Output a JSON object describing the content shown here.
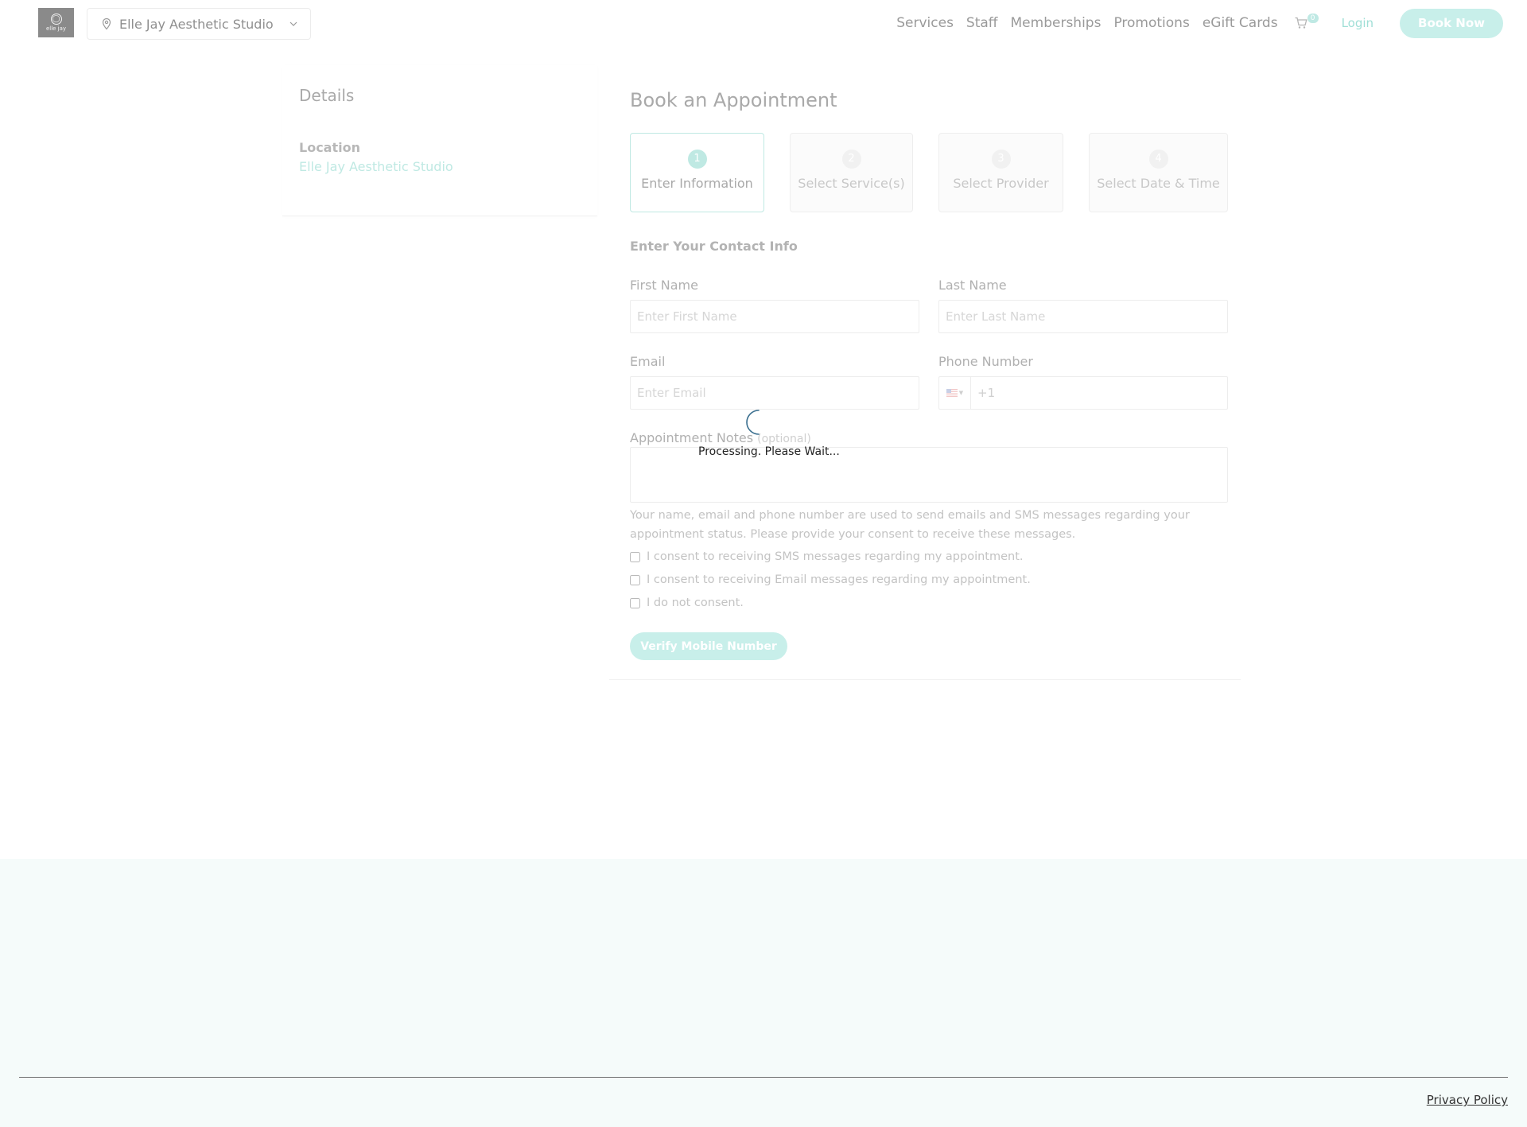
{
  "header": {
    "logo_text": "elle jay",
    "location": "Elle Jay Aesthetic Studio",
    "nav": [
      "Services",
      "Staff",
      "Memberships",
      "Promotions",
      "eGift Cards"
    ],
    "cart_count": "0",
    "login_label": "Login",
    "book_now_label": "Book Now"
  },
  "details": {
    "title": "Details",
    "location_label": "Location",
    "location_value": "Elle Jay Aesthetic Studio"
  },
  "booking": {
    "title": "Book an Appointment",
    "steps": [
      {
        "num": "1",
        "label": "Enter Information"
      },
      {
        "num": "2",
        "label": "Select Service(s)"
      },
      {
        "num": "3",
        "label": "Select Provider"
      },
      {
        "num": "4",
        "label": "Select Date & Time"
      }
    ],
    "contact_title": "Enter Your Contact Info",
    "first_name_label": "First Name",
    "first_name_placeholder": "Enter First Name",
    "last_name_label": "Last Name",
    "last_name_placeholder": "Enter Last Name",
    "email_label": "Email",
    "email_placeholder": "Enter Email",
    "phone_label": "Phone Number",
    "phone_placeholder": "+1",
    "notes_label": "Appointment Notes",
    "notes_optional": "(optional)",
    "consent_text": "Your name, email and phone number are used to send emails and SMS messages regarding your appointment status. Please provide your consent to receive these messages.",
    "consent_sms": "I consent to receiving SMS messages regarding my appointment.",
    "consent_email": "I consent to receiving Email messages regarding my appointment.",
    "consent_none": "I do not consent.",
    "verify_label": "Verify Mobile Number"
  },
  "footer": {
    "privacy_label": "Privacy Policy"
  },
  "overlay": {
    "processing_text": "Processing. Please Wait..."
  },
  "colors": {
    "accent": "#bfe9e3",
    "button_bg": "#c8efea",
    "footer_bg": "#f5fbfa",
    "spinner": "#3a6f8f"
  }
}
